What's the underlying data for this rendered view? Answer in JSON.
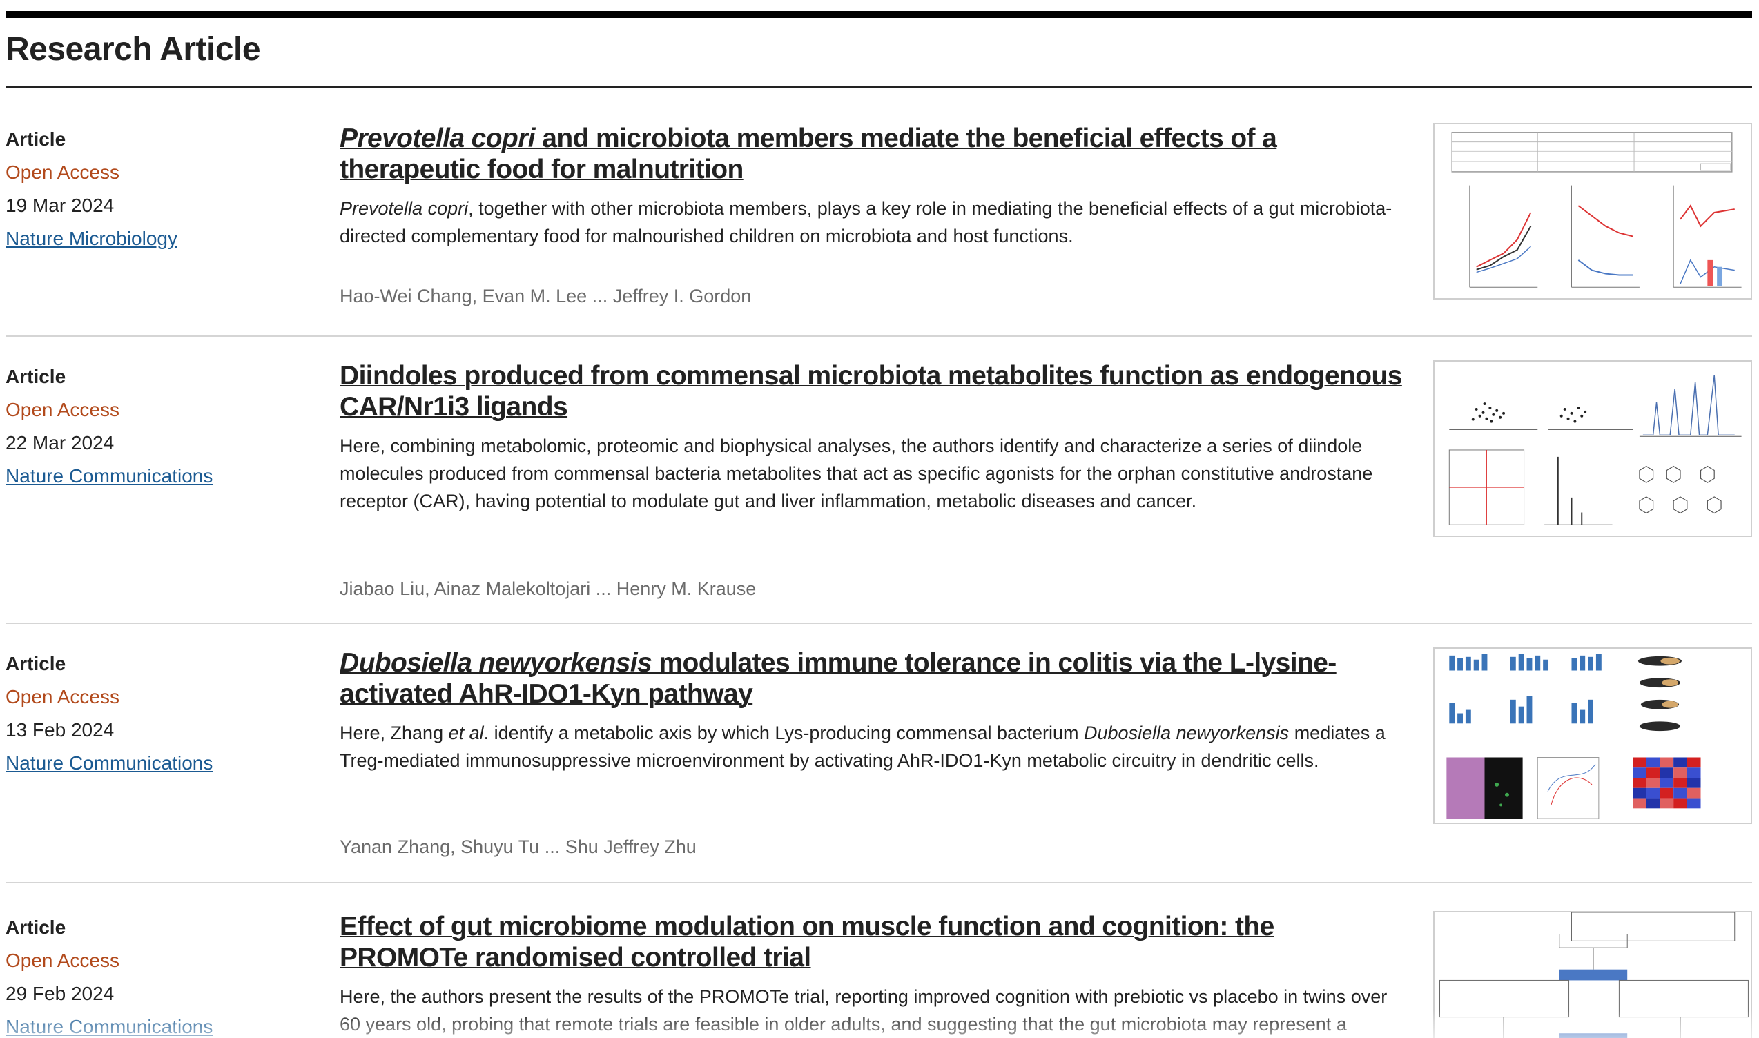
{
  "section": {
    "title": "Research Article"
  },
  "articles": [
    {
      "type": "Article",
      "access": "Open Access",
      "date": "19 Mar 2024",
      "journal": "Nature Microbiology",
      "title_italic": "Prevotella copri",
      "title_rest": " and microbiota members mediate the beneficial effects of a therapeutic food for malnutrition",
      "summary_italic": "Prevotella copri",
      "summary_rest": ", together with other microbiota members, plays a key role in mediating the beneficial effects of a gut microbiota-directed complementary food for malnourished children on microbiota and host functions.",
      "authors": "Hao-Wei Chang, Evan M. Lee ... Jeffrey I. Gordon",
      "thumbnail_icon": "figure-thumbnail-line-plots"
    },
    {
      "type": "Article",
      "access": "Open Access",
      "date": "22 Mar 2024",
      "journal": "Nature Communications",
      "title": "Diindoles produced from commensal microbiota metabolites function as endogenous CAR/Nr1i3 ligands",
      "summary": "Here, combining metabolomic, proteomic and biophysical analyses, the authors identify and characterize a series of diindole molecules produced from commensal bacteria metabolites that act as specific agonists for the orphan constitutive androstane receptor (CAR), having potential to modulate gut and liver inflammation, metabolic diseases and cancer.",
      "authors": "Jiabao Liu, Ainaz Malekoltojari ... Henry M. Krause",
      "thumbnail_icon": "figure-thumbnail-scatter-spectra"
    },
    {
      "type": "Article",
      "access": "Open Access",
      "date": "13 Feb 2024",
      "journal": "Nature Communications",
      "title_italic": "Dubosiella newyorkensis",
      "title_rest": " modulates immune tolerance in colitis via the L-lysine-activated AhR-IDO1-Kyn pathway",
      "summary_pre": "Here, Zhang ",
      "summary_etal": "et al",
      "summary_mid": ". identify a metabolic axis by which Lys-producing commensal bacterium ",
      "summary_species": "Dubosiella newyorkensis",
      "summary_post": " mediates a Treg-mediated immunosuppressive microenvironment by activating AhR-IDO1-Kyn metabolic circuitry in dendritic cells.",
      "authors": "Yanan Zhang, Shuyu Tu ... Shu Jeffrey Zhu",
      "thumbnail_icon": "figure-thumbnail-bars-heatmap"
    },
    {
      "type": "Article",
      "access": "Open Access",
      "date": "29 Feb 2024",
      "journal": "Nature Communications",
      "title": "Effect of gut microbiome modulation on muscle function and cognition: the PROMOTe randomised controlled trial",
      "summary": "Here, the authors present the results of the PROMOTe trial, reporting improved cognition with prebiotic vs placebo in twins over 60 years old, probing that remote trials are feasible in older adults, and suggesting that the gut microbiota may represent a therapeutic target for age-associated cognitive decline.",
      "thumbnail_icon": "figure-thumbnail-consort-flowchart"
    }
  ],
  "colors": {
    "open_access": "#b24a1c",
    "journal_link": "#1b5a92",
    "authors": "#6b6b6b"
  }
}
